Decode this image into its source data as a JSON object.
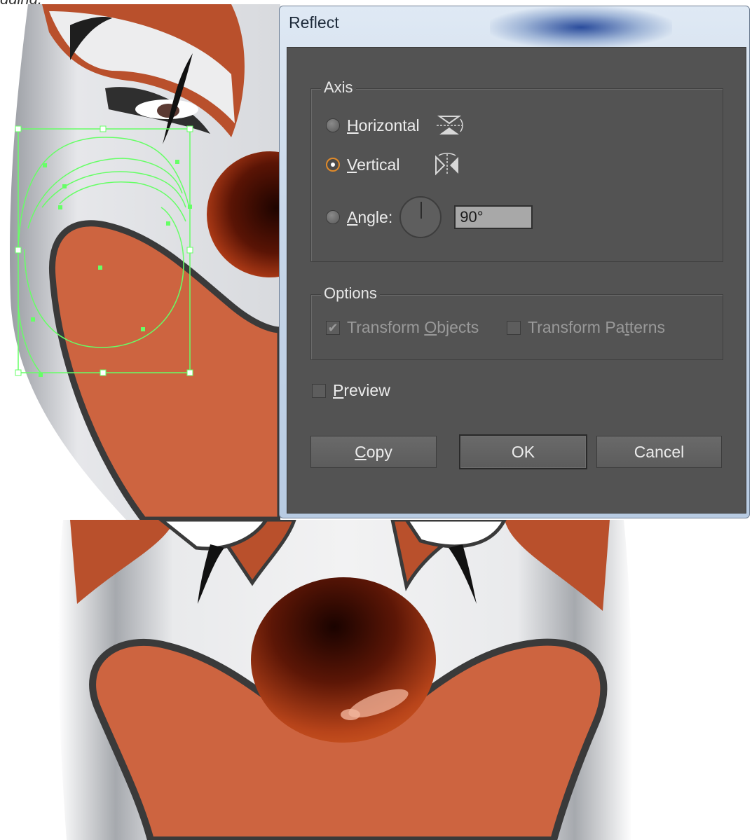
{
  "caption": "gging.",
  "dialog": {
    "title": "Reflect",
    "axis_group": {
      "label": "Axis",
      "horizontal": {
        "label": "Horizontal",
        "mnemonic": "H",
        "rest": "orizontal",
        "selected": false
      },
      "vertical": {
        "label": "Vertical",
        "mnemonic": "V",
        "rest": "ertical",
        "selected": true
      },
      "angle": {
        "label": "Angle:",
        "mnemonic": "A",
        "rest": "ngle:",
        "value": "90°",
        "selected": false
      }
    },
    "options_group": {
      "label": "Options",
      "transform_objects": {
        "label": "Transform Objects",
        "before": "Transform ",
        "mnemonic": "O",
        "after": "bjects",
        "checked": true,
        "enabled": false
      },
      "transform_patterns": {
        "label": "Transform Patterns",
        "before": "Transform Pa",
        "mnemonic": "t",
        "after": "terns",
        "checked": false,
        "enabled": false
      }
    },
    "preview": {
      "label": "Preview",
      "mnemonic": "P",
      "rest": "review",
      "checked": false
    },
    "buttons": {
      "copy": {
        "label": "Copy",
        "mnemonic": "C",
        "rest": "opy"
      },
      "ok": "OK",
      "cancel": "Cancel"
    }
  },
  "colors": {
    "dialog_bg": "#535353",
    "clown_red": "#cd6440",
    "outline": "#3a3a3a",
    "selection_green": "#66ff66",
    "nose": "#b23a16"
  },
  "icons": [
    "reflect-horizontal-icon",
    "reflect-vertical-icon",
    "angle-dial-icon",
    "checkmark-icon"
  ]
}
